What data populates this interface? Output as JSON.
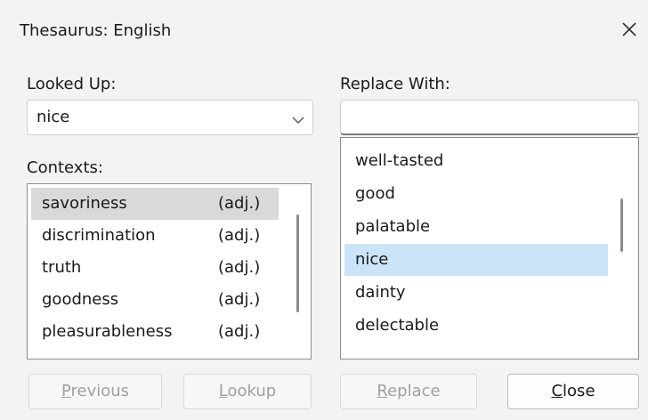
{
  "window": {
    "title": "Thesaurus: English"
  },
  "looked_up": {
    "label": "Looked Up:",
    "value": "nice"
  },
  "replace_with": {
    "label": "Replace With:",
    "value": ""
  },
  "contexts": {
    "label": "Contexts:",
    "items": [
      {
        "word": "savoriness",
        "pos": "(adj.)",
        "selected": true
      },
      {
        "word": "discrimination",
        "pos": "(adj.)"
      },
      {
        "word": "truth",
        "pos": "(adj.)"
      },
      {
        "word": "goodness",
        "pos": "(adj.)"
      },
      {
        "word": "pleasurableness",
        "pos": "(adj.)"
      }
    ]
  },
  "synonyms": {
    "items": [
      "well-tasted",
      "good",
      "palatable",
      "nice",
      "dainty",
      "delectable"
    ],
    "selected": "nice"
  },
  "buttons": {
    "previous": {
      "first": "P",
      "rest": "revious",
      "enabled": false
    },
    "lookup": {
      "first": "L",
      "rest": "ookup",
      "enabled": false
    },
    "replace": {
      "first": "R",
      "rest": "eplace",
      "enabled": false
    },
    "close": {
      "first": "C",
      "rest": "lose",
      "enabled": true
    }
  },
  "colors": {
    "selection_blue": "#cce4f7",
    "selection_gray": "#d9d9d9"
  }
}
